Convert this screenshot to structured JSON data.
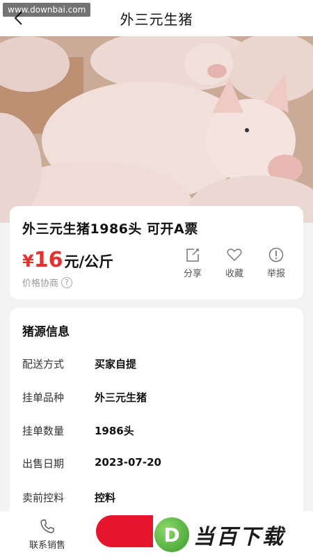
{
  "watermark": "www.downbai.com",
  "header": {
    "title": "外三元生猪"
  },
  "product": {
    "title": "外三元生猪1986头 可开A票",
    "price_symbol": "¥",
    "price_value": "16",
    "price_unit": "元/公斤",
    "negotiable": "价格协商",
    "actions": [
      {
        "label": "分享",
        "icon": "share-icon"
      },
      {
        "label": "收藏",
        "icon": "heart-icon"
      },
      {
        "label": "举报",
        "icon": "report-icon"
      }
    ]
  },
  "info": {
    "heading": "猪源信息",
    "rows": [
      {
        "label": "配送方式",
        "value": "买家自提"
      },
      {
        "label": "挂单品种",
        "value": "外三元生猪"
      },
      {
        "label": "挂单数量",
        "value": "1986头"
      },
      {
        "label": "出售日期",
        "value": "2023-07-20"
      },
      {
        "label": "卖前控料",
        "value": "控料"
      }
    ]
  },
  "bottom": {
    "contact_label": "联系销售",
    "logo_letter": "D",
    "logo_text": "当百下载"
  },
  "colors": {
    "accent": "#e5312f",
    "buy_button": "#e6142d",
    "logo_green": "#4caf2f"
  }
}
